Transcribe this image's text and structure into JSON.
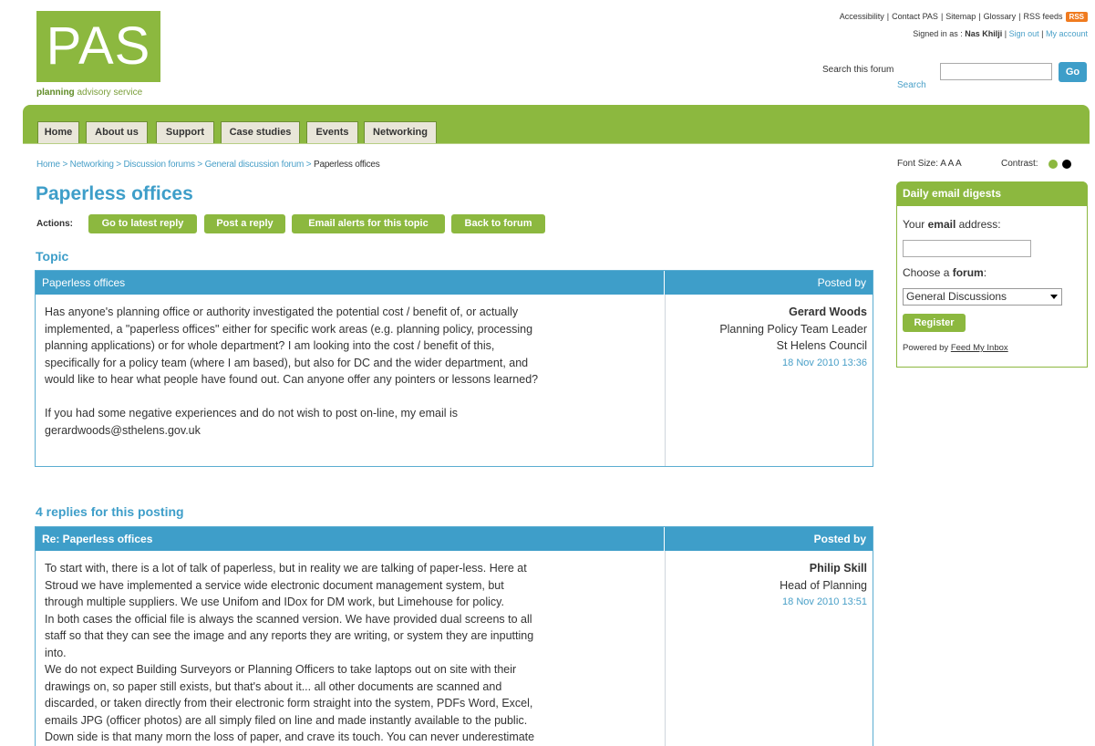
{
  "logo": {
    "text": "PAS",
    "tag_bold": "planning",
    "tag_rest": " advisory service"
  },
  "utility": {
    "links": [
      "Accessibility",
      "Contact PAS",
      "Sitemap",
      "Glossary",
      "RSS feeds"
    ],
    "rss_badge": "RSS",
    "signed_in_prefix": "Signed in as : ",
    "user": "Nas Khilji",
    "sign_out": "Sign out",
    "my_account": "My account"
  },
  "search": {
    "label": "Search this forum",
    "sub": "Search",
    "value": "",
    "go": "Go"
  },
  "nav": {
    "tabs": [
      "Home",
      "About us",
      "Support",
      "Case studies",
      "Events",
      "Networking"
    ]
  },
  "breadcrumb": {
    "items": [
      "Home",
      "Networking",
      "Discussion forums",
      "General discussion forum"
    ],
    "separator": " > ",
    "current": "Paperless offices"
  },
  "page": {
    "title": "Paperless offices",
    "actions_label": "Actions:",
    "actions": [
      "Go to latest reply",
      "Post a reply",
      "Email alerts for this topic",
      "Back to forum"
    ],
    "topic_heading": "Topic",
    "replies_heading": "4 replies for this posting"
  },
  "topic": {
    "title": "Paperless offices",
    "posted_by_label": "Posted by",
    "body": "Has anyone's planning office or authority investigated the potential cost / benefit of, or actually\nimplemented, a \"paperless offices\" either for specific work areas (e.g. planning policy, processing\nplanning applications) or for whole department? I am looking into the cost / benefit of this,\nspecifically for a policy team (where I am based), but also for DC and the wider department, and\nwould like to hear what people have found out. Can anyone offer any pointers or lessons learned?\n\nIf you had some negative experiences and do not wish to post on-line, my email is\ngerardwoods@sthelens.gov.uk",
    "author": "Gerard Woods",
    "role": "Planning Policy Team Leader",
    "org": "St Helens Council",
    "date": "18 Nov 2010 13:36"
  },
  "reply": {
    "title": "Re: Paperless offices",
    "posted_by_label": "Posted by",
    "body": "To start with, there is a lot of talk of paperless, but in reality we are talking of paper-less. Here at\nStroud we have implemented a service wide electronic document management system, but\nthrough multiple suppliers. We use Unifom and IDox for DM work, but Limehouse for policy.\nIn both cases the official file is always the scanned version. We have provided dual screens to all\nstaff so that they can see the image and any reports they are writing, or system they are inputting\ninto.\nWe do not expect Building Surveyors or Planning Officers to take laptops out on site with their\ndrawings on, so paper still exists, but that's about it... all other documents are scanned and\ndiscarded, or taken directly from their electronic form straight into the system, PDFs Word, Excel,\nemails JPG (officer photos) are all simply filed on line and made instantly available to the public.\nDown side is that many morn the loss of paper, and crave its touch. You can never underestimate",
    "author": "Philip Skill",
    "role": "Head of Planning",
    "date": "18 Nov 2010 13:51"
  },
  "sidebar": {
    "font_size_label": "Font Size:",
    "font_size_glyphs": "A A A",
    "contrast_label": "Contrast:",
    "digest_title": "Daily email digests",
    "email_label_prefix": "Your ",
    "email_label_bold": "email",
    "email_label_suffix": " address:",
    "email_value": "",
    "forum_label_prefix": "Choose a ",
    "forum_label_bold": "forum",
    "forum_label_suffix": ":",
    "forum_selected": "General Discussions",
    "register": "Register",
    "powered_prefix": "Powered by ",
    "powered_link": "Feed My Inbox"
  },
  "colors": {
    "green": "#8cb83f",
    "blue": "#3e9ec9",
    "orange": "#f07b1f"
  }
}
